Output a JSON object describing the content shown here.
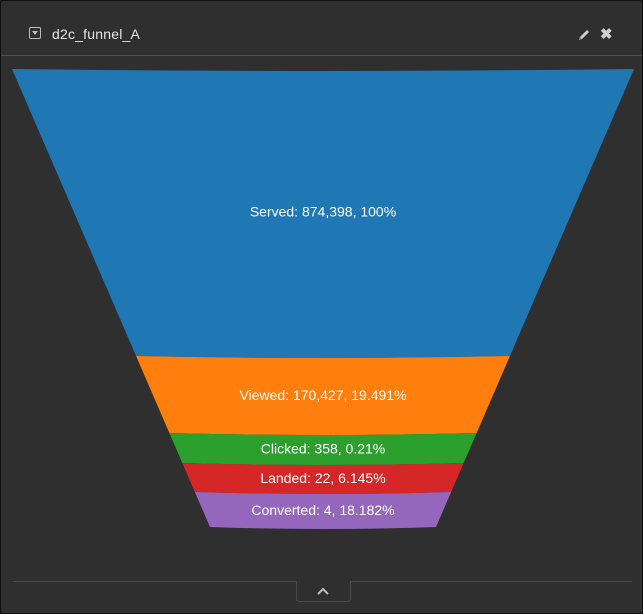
{
  "widget": {
    "title": "d2c_funnel_A",
    "icons": {
      "collapse": "collapse-dropdown-icon",
      "edit": "pencil-icon",
      "close": "close-x-icon",
      "expand": "chevron-up-icon"
    }
  },
  "chart_data": {
    "type": "funnel",
    "title": "",
    "stages": [
      {
        "name": "Served",
        "value": 874398,
        "percent": "100%",
        "label": "Served: 874,398, 100%",
        "color": "#1f77b4"
      },
      {
        "name": "Viewed",
        "value": 170427,
        "percent": "19.491%",
        "label": "Viewed: 170,427, 19.491%",
        "color": "#ff7f0e"
      },
      {
        "name": "Clicked",
        "value": 358,
        "percent": "0.21%",
        "label": "Clicked: 358, 0.21%",
        "color": "#2ca02c"
      },
      {
        "name": "Landed",
        "value": 22,
        "percent": "6.145%",
        "label": "Landed: 22, 6.145%",
        "color": "#d62728"
      },
      {
        "name": "Converted",
        "value": 4,
        "percent": "18.182%",
        "label": "Converted: 4, 18.182%",
        "color": "#9467bd"
      }
    ]
  }
}
